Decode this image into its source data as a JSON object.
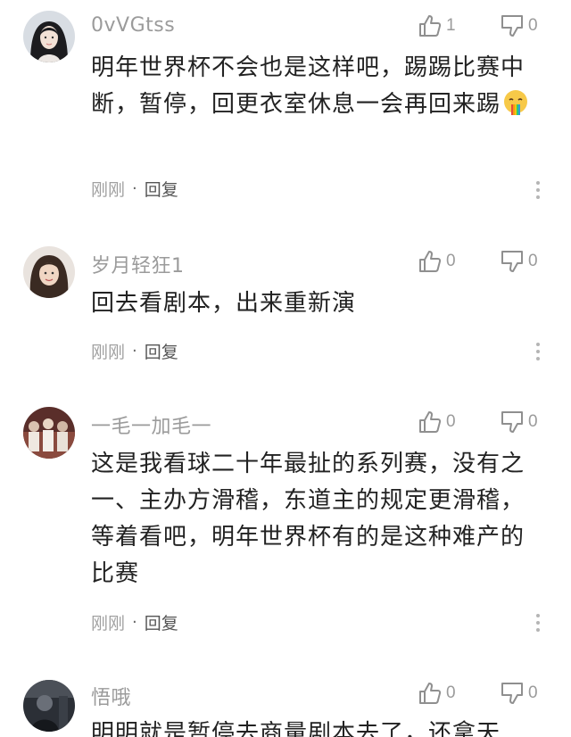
{
  "colors": {
    "text": "#222222",
    "muted": "#9b9b9b",
    "background": "#ffffff"
  },
  "comments": [
    {
      "username": "0vVGtss",
      "likes": "1",
      "dislikes": "0",
      "text": "明年世界杯不会也是这样吧，踢踢比赛中断，暂停，回更衣室休息一会再回来踢",
      "emoji": "nauseated-face-icon",
      "time": "刚刚",
      "separator": "·",
      "reply_label": "回复"
    },
    {
      "username": "岁月轻狂1",
      "likes": "0",
      "dislikes": "0",
      "text": "回去看剧本，出来重新演",
      "time": "刚刚",
      "separator": "·",
      "reply_label": "回复"
    },
    {
      "username": "一毛一加毛一",
      "likes": "0",
      "dislikes": "0",
      "text": "这是我看球二十年最扯的系列赛，没有之一、主办方滑稽，东道主的规定更滑稽，等着看吧，明年世界杯有的是这种难产的比赛",
      "time": "刚刚",
      "separator": "·",
      "reply_label": "回复"
    },
    {
      "username": "悟哦",
      "likes": "0",
      "dislikes": "0",
      "text": "明明就是暂停去商量剧本去了，还拿天"
    }
  ]
}
